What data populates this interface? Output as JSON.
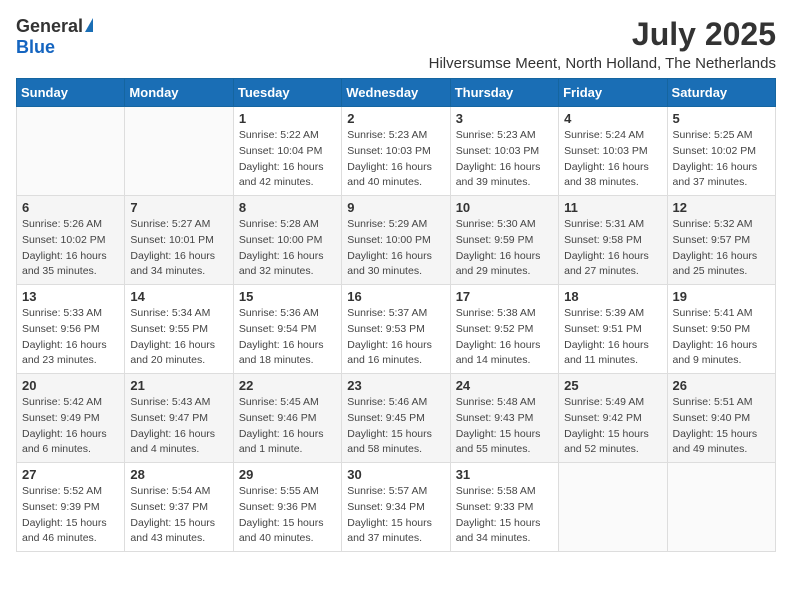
{
  "logo": {
    "general": "General",
    "blue": "Blue"
  },
  "title": "July 2025",
  "location": "Hilversumse Meent, North Holland, The Netherlands",
  "days_of_week": [
    "Sunday",
    "Monday",
    "Tuesday",
    "Wednesday",
    "Thursday",
    "Friday",
    "Saturday"
  ],
  "weeks": [
    [
      {
        "day": "",
        "info": ""
      },
      {
        "day": "",
        "info": ""
      },
      {
        "day": "1",
        "info": "Sunrise: 5:22 AM\nSunset: 10:04 PM\nDaylight: 16 hours\nand 42 minutes."
      },
      {
        "day": "2",
        "info": "Sunrise: 5:23 AM\nSunset: 10:03 PM\nDaylight: 16 hours\nand 40 minutes."
      },
      {
        "day": "3",
        "info": "Sunrise: 5:23 AM\nSunset: 10:03 PM\nDaylight: 16 hours\nand 39 minutes."
      },
      {
        "day": "4",
        "info": "Sunrise: 5:24 AM\nSunset: 10:03 PM\nDaylight: 16 hours\nand 38 minutes."
      },
      {
        "day": "5",
        "info": "Sunrise: 5:25 AM\nSunset: 10:02 PM\nDaylight: 16 hours\nand 37 minutes."
      }
    ],
    [
      {
        "day": "6",
        "info": "Sunrise: 5:26 AM\nSunset: 10:02 PM\nDaylight: 16 hours\nand 35 minutes."
      },
      {
        "day": "7",
        "info": "Sunrise: 5:27 AM\nSunset: 10:01 PM\nDaylight: 16 hours\nand 34 minutes."
      },
      {
        "day": "8",
        "info": "Sunrise: 5:28 AM\nSunset: 10:00 PM\nDaylight: 16 hours\nand 32 minutes."
      },
      {
        "day": "9",
        "info": "Sunrise: 5:29 AM\nSunset: 10:00 PM\nDaylight: 16 hours\nand 30 minutes."
      },
      {
        "day": "10",
        "info": "Sunrise: 5:30 AM\nSunset: 9:59 PM\nDaylight: 16 hours\nand 29 minutes."
      },
      {
        "day": "11",
        "info": "Sunrise: 5:31 AM\nSunset: 9:58 PM\nDaylight: 16 hours\nand 27 minutes."
      },
      {
        "day": "12",
        "info": "Sunrise: 5:32 AM\nSunset: 9:57 PM\nDaylight: 16 hours\nand 25 minutes."
      }
    ],
    [
      {
        "day": "13",
        "info": "Sunrise: 5:33 AM\nSunset: 9:56 PM\nDaylight: 16 hours\nand 23 minutes."
      },
      {
        "day": "14",
        "info": "Sunrise: 5:34 AM\nSunset: 9:55 PM\nDaylight: 16 hours\nand 20 minutes."
      },
      {
        "day": "15",
        "info": "Sunrise: 5:36 AM\nSunset: 9:54 PM\nDaylight: 16 hours\nand 18 minutes."
      },
      {
        "day": "16",
        "info": "Sunrise: 5:37 AM\nSunset: 9:53 PM\nDaylight: 16 hours\nand 16 minutes."
      },
      {
        "day": "17",
        "info": "Sunrise: 5:38 AM\nSunset: 9:52 PM\nDaylight: 16 hours\nand 14 minutes."
      },
      {
        "day": "18",
        "info": "Sunrise: 5:39 AM\nSunset: 9:51 PM\nDaylight: 16 hours\nand 11 minutes."
      },
      {
        "day": "19",
        "info": "Sunrise: 5:41 AM\nSunset: 9:50 PM\nDaylight: 16 hours\nand 9 minutes."
      }
    ],
    [
      {
        "day": "20",
        "info": "Sunrise: 5:42 AM\nSunset: 9:49 PM\nDaylight: 16 hours\nand 6 minutes."
      },
      {
        "day": "21",
        "info": "Sunrise: 5:43 AM\nSunset: 9:47 PM\nDaylight: 16 hours\nand 4 minutes."
      },
      {
        "day": "22",
        "info": "Sunrise: 5:45 AM\nSunset: 9:46 PM\nDaylight: 16 hours\nand 1 minute."
      },
      {
        "day": "23",
        "info": "Sunrise: 5:46 AM\nSunset: 9:45 PM\nDaylight: 15 hours\nand 58 minutes."
      },
      {
        "day": "24",
        "info": "Sunrise: 5:48 AM\nSunset: 9:43 PM\nDaylight: 15 hours\nand 55 minutes."
      },
      {
        "day": "25",
        "info": "Sunrise: 5:49 AM\nSunset: 9:42 PM\nDaylight: 15 hours\nand 52 minutes."
      },
      {
        "day": "26",
        "info": "Sunrise: 5:51 AM\nSunset: 9:40 PM\nDaylight: 15 hours\nand 49 minutes."
      }
    ],
    [
      {
        "day": "27",
        "info": "Sunrise: 5:52 AM\nSunset: 9:39 PM\nDaylight: 15 hours\nand 46 minutes."
      },
      {
        "day": "28",
        "info": "Sunrise: 5:54 AM\nSunset: 9:37 PM\nDaylight: 15 hours\nand 43 minutes."
      },
      {
        "day": "29",
        "info": "Sunrise: 5:55 AM\nSunset: 9:36 PM\nDaylight: 15 hours\nand 40 minutes."
      },
      {
        "day": "30",
        "info": "Sunrise: 5:57 AM\nSunset: 9:34 PM\nDaylight: 15 hours\nand 37 minutes."
      },
      {
        "day": "31",
        "info": "Sunrise: 5:58 AM\nSunset: 9:33 PM\nDaylight: 15 hours\nand 34 minutes."
      },
      {
        "day": "",
        "info": ""
      },
      {
        "day": "",
        "info": ""
      }
    ]
  ]
}
